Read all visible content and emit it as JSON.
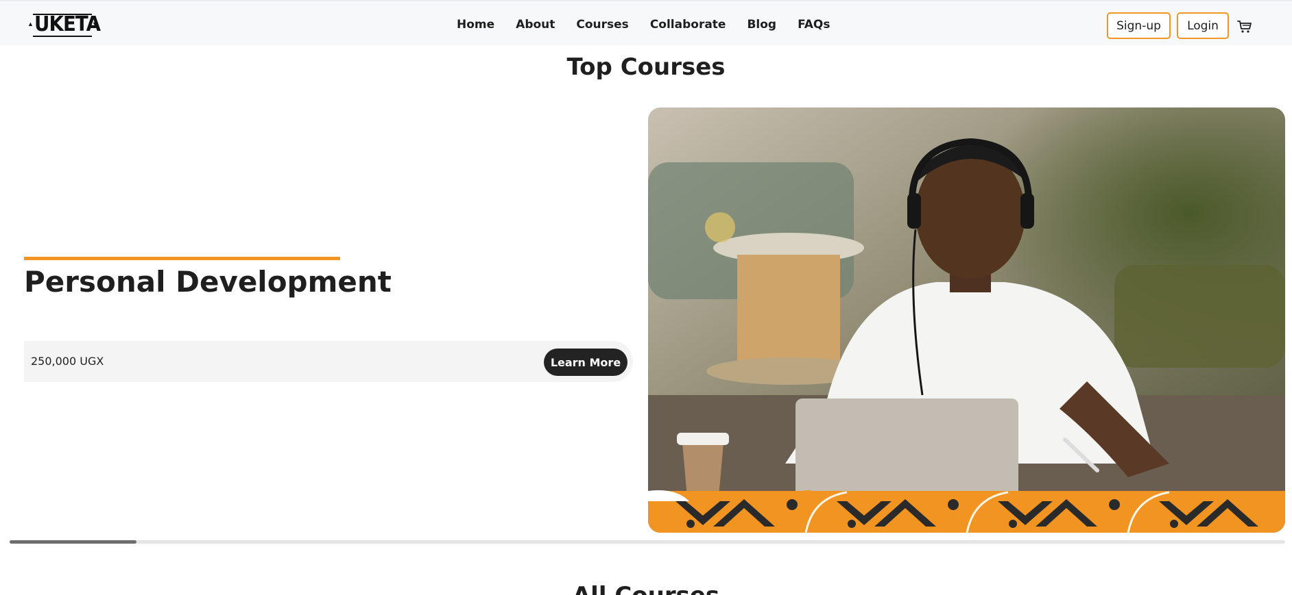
{
  "brand": {
    "logo_text": "UKETA"
  },
  "nav": {
    "items": [
      "Home",
      "About",
      "Courses",
      "Collaborate",
      "Blog",
      "FAQs"
    ]
  },
  "header_actions": {
    "signup_label": "Sign-up",
    "login_label": "Login",
    "cart_icon": "cart-icon"
  },
  "top_courses": {
    "title": "Top Courses",
    "slide": {
      "course_name": "Personal Development",
      "price": "250,000 UGX",
      "cta_label": "Learn More",
      "image_icon": "course-hero-image"
    },
    "scroll_progress": 0.1
  },
  "all_courses": {
    "title": "All Courses"
  },
  "colors": {
    "accent": "#f29422",
    "dark": "#232323",
    "header_bg": "#f7f8fa"
  }
}
